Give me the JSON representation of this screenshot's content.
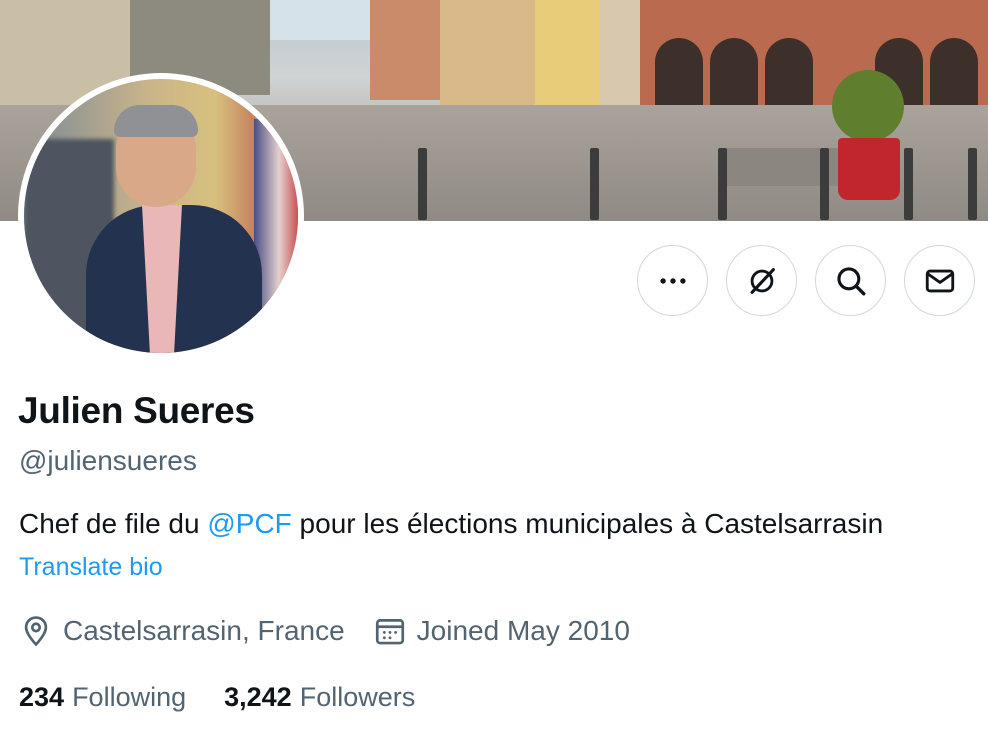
{
  "profile": {
    "name": "Julien Sueres",
    "handle": "@juliensueres",
    "bio_before": "Chef de file du ",
    "bio_mention": "@PCF",
    "bio_after": " pour les élections municipales à Castelsarrasin",
    "translate_label": "Translate bio",
    "location": "Castelsarrasin, France",
    "joined": "Joined May 2010"
  },
  "stats": {
    "following_count": "234",
    "following_label": "Following",
    "followers_count": "3,242",
    "followers_label": "Followers"
  },
  "actions": [
    {
      "icon": "more-icon"
    },
    {
      "icon": "grok-icon"
    },
    {
      "icon": "search-icon"
    },
    {
      "icon": "mail-icon"
    }
  ],
  "colors": {
    "accent": "#1d9bf0",
    "text": "#0f1419",
    "secondary": "#536471",
    "border": "#cfd9de"
  }
}
